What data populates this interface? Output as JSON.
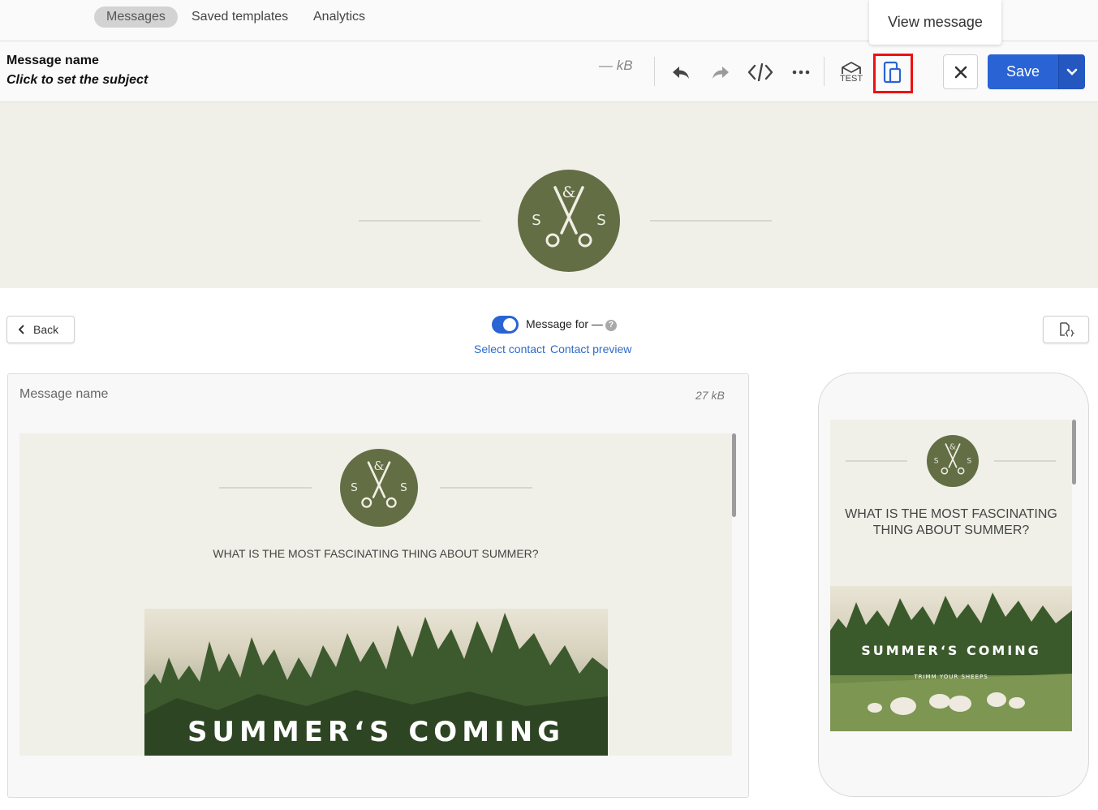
{
  "nav": {
    "tabs": [
      {
        "label": "Messages",
        "active": true
      },
      {
        "label": "Saved templates",
        "active": false
      },
      {
        "label": "Analytics",
        "active": false
      }
    ],
    "tooltip": "View message"
  },
  "toolbar": {
    "message_name": "Message name",
    "subject_placeholder": "Click to set the subject",
    "size": "— kB",
    "test_label": "TEST",
    "save_label": "Save",
    "icons": [
      "undo-icon",
      "redo-icon",
      "code-icon",
      "more-icon",
      "test-send-icon",
      "view-message-icon",
      "close-icon",
      "chevron-down-icon"
    ],
    "colors": {
      "primary": "#2a63d4",
      "highlight": "#ee1111"
    }
  },
  "banner": {
    "logo_top": "&",
    "logo_left": "S",
    "logo_right": "S",
    "logo_color": "#636e45",
    "background": "#f0f0e9"
  },
  "controls": {
    "back_label": "Back",
    "message_for": "Message for —",
    "help": "?",
    "select_contact": "Select contact",
    "contact_preview": "Contact preview",
    "toggle_on": true
  },
  "desktop_preview": {
    "message_name": "Message name",
    "size": "27 kB",
    "headline": "WHAT IS THE MOST FASCINATING THING ABOUT SUMMER?",
    "hero_title": "SUMMER‘S COMING"
  },
  "mobile_preview": {
    "headline": "WHAT IS THE MOST FASCINATING THING ABOUT SUMMER?",
    "hero_title": "SUMMER‘S COMING",
    "hero_subtitle": "TRIMM YOUR SHEEPS"
  }
}
